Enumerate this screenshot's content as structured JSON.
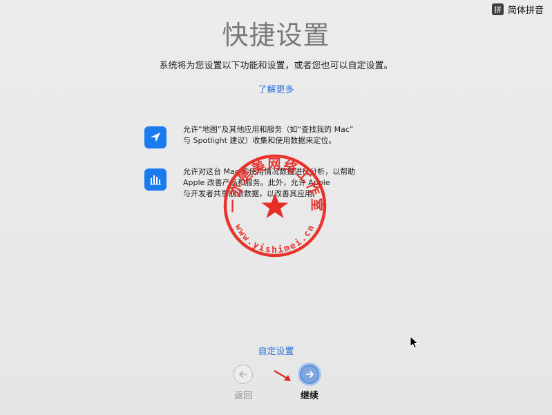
{
  "input_menu": {
    "icon_char": "拼",
    "label": "简体拼音"
  },
  "title": "快捷设置",
  "subtitle": "系统将为您设置以下功能和设置，或者您也可以自定设置。",
  "learn_more": "了解更多",
  "options": [
    {
      "icon": "location-arrow-icon",
      "lines": [
        "允许“地图”及其他应用和服务（如“查找我的 Mac”",
        "与 Spotlight 建议）收集和使用数据来定位。"
      ]
    },
    {
      "icon": "bar-chart-icon",
      "lines": [
        "允许对这台 Mac 的使用情况数据进行分析，以帮助",
        "Apple 改善产品和服务。此外，允许 Apple",
        "与开发者共享崩溃数据，以改善其应用。"
      ]
    }
  ],
  "stamp": {
    "text": "一亦是美网络工作室",
    "url": "www.yishimei.cn"
  },
  "custom_setup": "自定设置",
  "nav": {
    "back_label": "返回",
    "continue_label": "继续"
  },
  "colors": {
    "accent": "#2a6fd6",
    "icon_blue": "#1a7bef",
    "stamp_red": "#e8231c"
  }
}
